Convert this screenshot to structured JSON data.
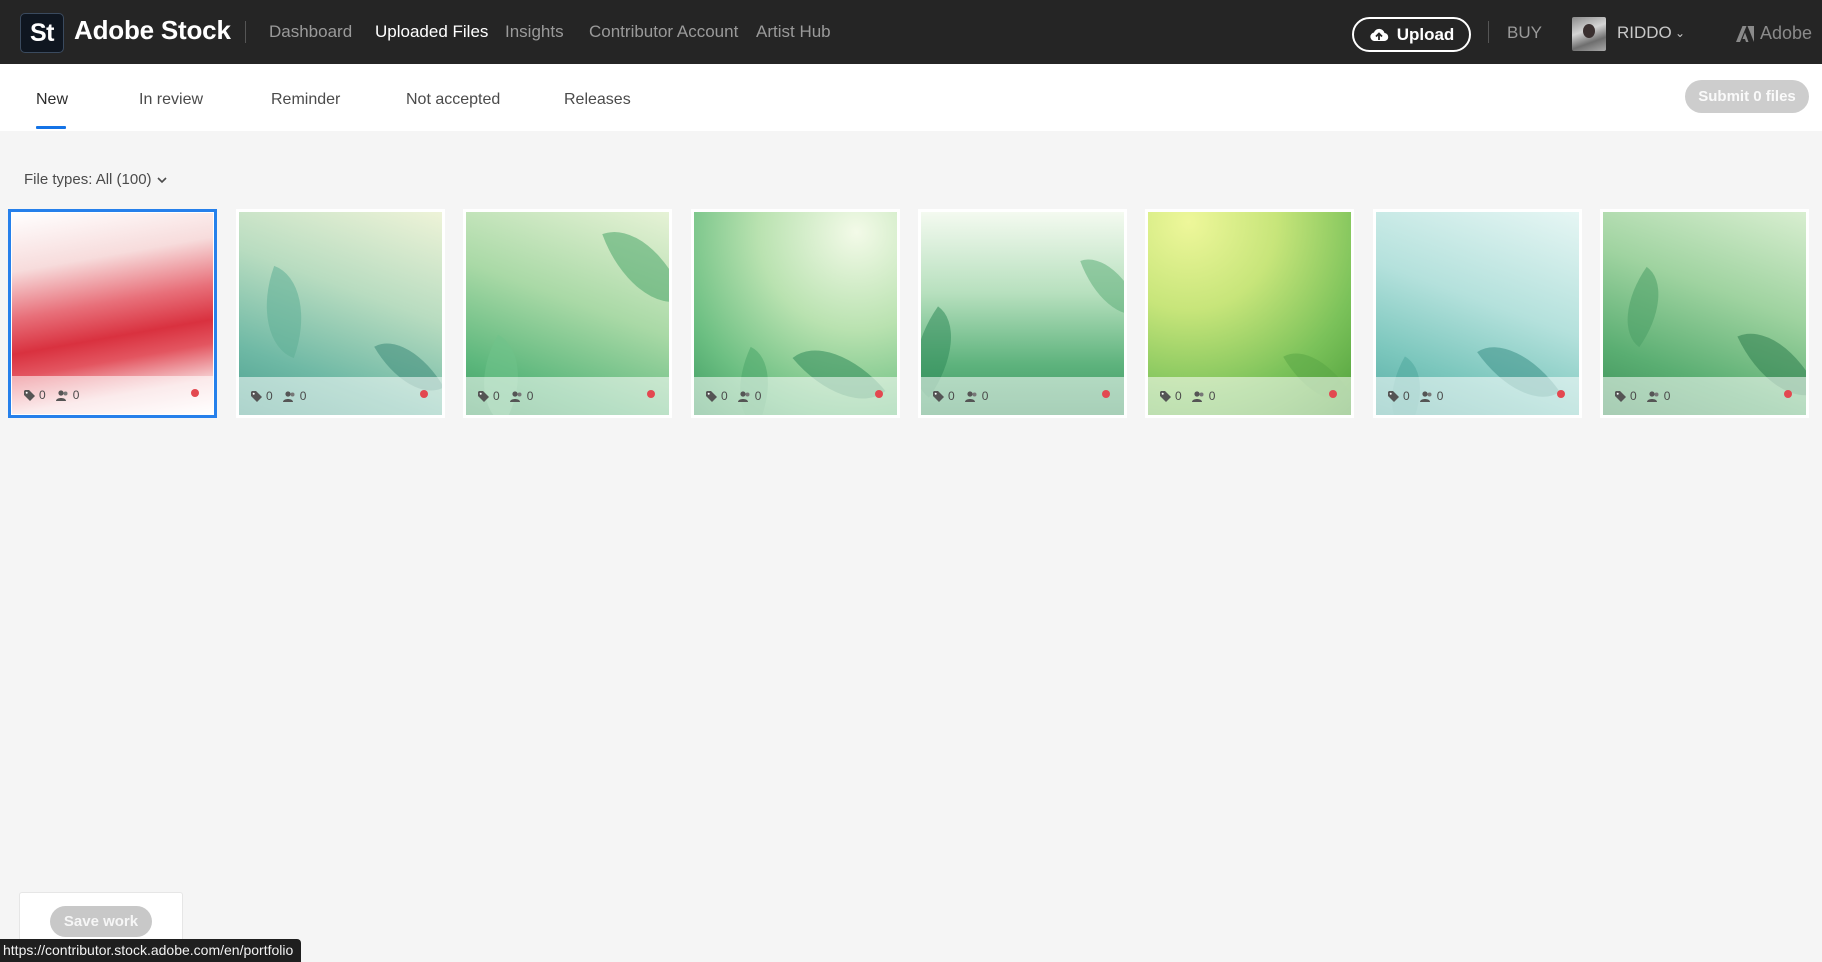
{
  "app": {
    "logo_text": "St",
    "brand": "Adobe Stock"
  },
  "nav": [
    {
      "label": "Dashboard",
      "active": false
    },
    {
      "label": "Uploaded Files",
      "active": true
    },
    {
      "label": "Insights",
      "active": false
    },
    {
      "label": "Contributor Account",
      "active": false
    },
    {
      "label": "Artist Hub",
      "active": false
    }
  ],
  "header": {
    "upload_label": "Upload",
    "buy_label": "BUY",
    "username": "RIDDO",
    "adobe_label": "Adobe"
  },
  "tabs": [
    {
      "label": "New",
      "active": true
    },
    {
      "label": "In review",
      "active": false
    },
    {
      "label": "Reminder",
      "active": false
    },
    {
      "label": "Not accepted",
      "active": false
    },
    {
      "label": "Releases",
      "active": false
    }
  ],
  "submit_label": "Submit 0 files",
  "filter": {
    "label": "File types: All (100)"
  },
  "files": [
    {
      "keywords": "0",
      "people": "0",
      "theme": "red-silk",
      "selected": true
    },
    {
      "keywords": "0",
      "people": "0",
      "theme": "teal-mist",
      "selected": false
    },
    {
      "keywords": "0",
      "people": "0",
      "theme": "green-leaves",
      "selected": false
    },
    {
      "keywords": "0",
      "people": "0",
      "theme": "green-leaves-2",
      "selected": false
    },
    {
      "keywords": "0",
      "people": "0",
      "theme": "green-fade",
      "selected": false
    },
    {
      "keywords": "0",
      "people": "0",
      "theme": "lime-glow",
      "selected": false
    },
    {
      "keywords": "0",
      "people": "0",
      "theme": "aqua-leaves",
      "selected": false
    },
    {
      "keywords": "0",
      "people": "0",
      "theme": "forest-green",
      "selected": false
    }
  ],
  "save_label": "Save work",
  "status_url": "https://contributor.stock.adobe.com/en/portfolio",
  "colors": {
    "topbar": "#252525",
    "accent": "#1473e6",
    "status_dot": "#e34850"
  }
}
